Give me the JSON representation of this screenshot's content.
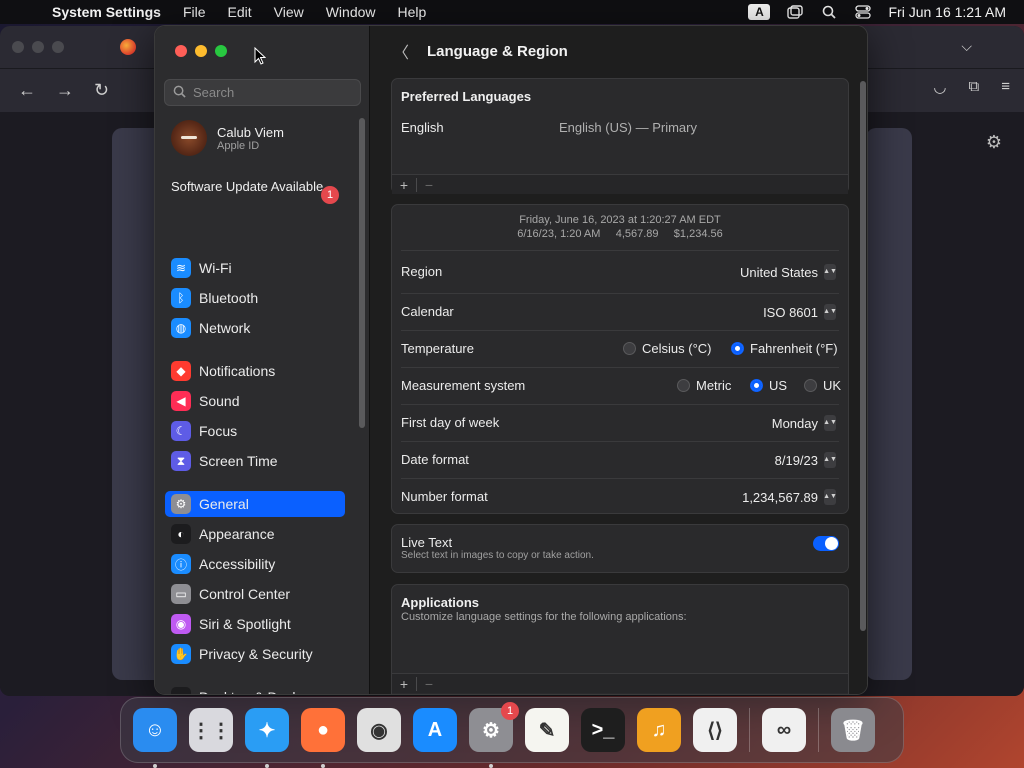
{
  "menubar": {
    "app_name": "System Settings",
    "menus": [
      "File",
      "Edit",
      "View",
      "Window",
      "Help"
    ],
    "keyboard_badge": "A",
    "clock": "Fri Jun 16  1:21 AM",
    "icons": [
      "window-icon",
      "search-icon",
      "control-center-icon"
    ]
  },
  "sidebar": {
    "search_placeholder": "Search",
    "profile": {
      "name": "Calub Viem",
      "sub": "Apple ID"
    },
    "update": {
      "label": "Software Update Available",
      "badge": "1"
    },
    "items": [
      {
        "label": "Wi-Fi",
        "icon": "wifi-icon",
        "color": "#1a8cff"
      },
      {
        "label": "Bluetooth",
        "icon": "bluetooth-icon",
        "color": "#1a8cff"
      },
      {
        "label": "Network",
        "icon": "globe-icon",
        "color": "#1a8cff"
      },
      {
        "label": "Notifications",
        "icon": "bell-icon",
        "color": "#ff3b30"
      },
      {
        "label": "Sound",
        "icon": "speaker-icon",
        "color": "#ff2d55"
      },
      {
        "label": "Focus",
        "icon": "moon-icon",
        "color": "#5e5ce6"
      },
      {
        "label": "Screen Time",
        "icon": "hourglass-icon",
        "color": "#5e5ce6"
      },
      {
        "label": "General",
        "icon": "gear-icon",
        "color": "#8e8e93"
      },
      {
        "label": "Appearance",
        "icon": "appearance-icon",
        "color": "#1c1c1e"
      },
      {
        "label": "Accessibility",
        "icon": "accessibility-icon",
        "color": "#1a8cff"
      },
      {
        "label": "Control Center",
        "icon": "toggles-icon",
        "color": "#8e8e93"
      },
      {
        "label": "Siri & Spotlight",
        "icon": "siri-icon",
        "color": "#bf5af2"
      },
      {
        "label": "Privacy & Security",
        "icon": "hand-icon",
        "color": "#1a8cff"
      },
      {
        "label": "Desktop & Dock",
        "icon": "dock-icon",
        "color": "#1c1c1e"
      }
    ]
  },
  "main": {
    "title": "Language & Region",
    "preferred": {
      "title": "Preferred Languages",
      "language": "English",
      "detail": "English (US) — Primary"
    },
    "preview": {
      "line1": "Friday, June 16, 2023 at 1:20:27 AM EDT",
      "line2": "6/16/23, 1:20 AM     4,567.89     $1,234.56"
    },
    "rows": {
      "region": {
        "label": "Region",
        "value": "United States"
      },
      "calendar": {
        "label": "Calendar",
        "value": "ISO 8601"
      },
      "temperature": {
        "label": "Temperature",
        "opt1": "Celsius (°C)",
        "opt2": "Fahrenheit (°F)",
        "selected": "Fahrenheit (°F)"
      },
      "measurement": {
        "label": "Measurement system",
        "opt1": "Metric",
        "opt2": "US",
        "opt3": "UK",
        "selected": "US"
      },
      "firstday": {
        "label": "First day of week",
        "value": "Monday"
      },
      "dateformat": {
        "label": "Date format",
        "value": "8/19/23"
      },
      "numberformat": {
        "label": "Number format",
        "value": "1,234,567.89"
      }
    },
    "livetext": {
      "title": "Live Text",
      "desc": "Select text in images to copy or take action.",
      "enabled": true
    },
    "applications": {
      "title": "Applications",
      "desc": "Customize language settings for the following applications:"
    },
    "plus": "+",
    "minus": "−"
  },
  "dock": {
    "apps": [
      {
        "name": "Finder",
        "icon": "finder-icon",
        "color": "#2a8cf0",
        "glyph": "☺",
        "running": true
      },
      {
        "name": "Launchpad",
        "icon": "launchpad-icon",
        "color": "#d9d9de",
        "glyph": "⋮⋮",
        "running": false
      },
      {
        "name": "Safari",
        "icon": "safari-icon",
        "color": "#2a9df4",
        "glyph": "✦",
        "running": true
      },
      {
        "name": "Firefox",
        "icon": "firefox-icon",
        "color": "#ff7139",
        "glyph": "●",
        "running": true
      },
      {
        "name": "Chrome",
        "icon": "chrome-icon",
        "color": "#e0e0e0",
        "glyph": "◉",
        "running": false
      },
      {
        "name": "App Store",
        "icon": "appstore-icon",
        "color": "#1a8cff",
        "glyph": "A",
        "running": false
      },
      {
        "name": "System Settings",
        "icon": "settings-icon",
        "color": "#8e8e93",
        "glyph": "⚙",
        "running": true,
        "badge": "1"
      },
      {
        "name": "TextEdit",
        "icon": "textedit-icon",
        "color": "#f5f5f0",
        "glyph": "✎",
        "running": false
      },
      {
        "name": "Terminal",
        "icon": "terminal-icon",
        "color": "#1e1e1e",
        "glyph": ">_",
        "running": false
      },
      {
        "name": "GarageBand",
        "icon": "garageband-icon",
        "color": "#f0a020",
        "glyph": "♫",
        "running": false
      },
      {
        "name": "VS Code",
        "icon": "vscode-icon",
        "color": "#f0f0f0",
        "glyph": "⟨⟩",
        "running": false
      },
      {
        "name": "Visual Studio",
        "icon": "visualstudio-icon",
        "color": "#f0f0f0",
        "glyph": "∞",
        "running": false
      },
      {
        "name": "Trash",
        "icon": "trash-icon",
        "color": "#8a8a8f",
        "glyph": "🗑",
        "running": false
      }
    ]
  }
}
